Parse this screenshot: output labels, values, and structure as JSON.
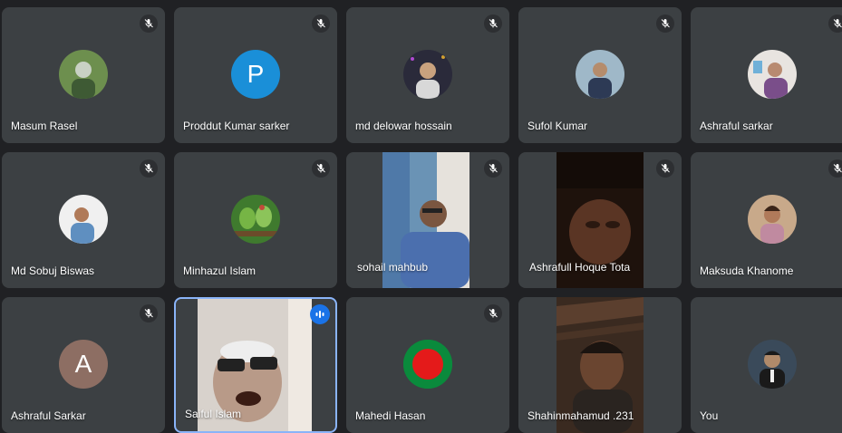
{
  "participants": [
    {
      "name": "Masum Rasel",
      "avatar_type": "photo",
      "avatar_icon": "person-photo-icon",
      "colors": [
        "#6d8f4e",
        "#c9d1c4",
        "#3e5a34"
      ],
      "muted": true
    },
    {
      "name": "Proddut Kumar sarker",
      "avatar_type": "letter",
      "letter": "P",
      "colors": [
        "#1a8fd8"
      ],
      "muted": true
    },
    {
      "name": "md delowar hossain",
      "avatar_type": "photo",
      "avatar_icon": "person-photo-icon",
      "colors": [
        "#2a2a3a",
        "#c9a27e",
        "#6b4b8a"
      ],
      "muted": true
    },
    {
      "name": "Sufol Kumar",
      "avatar_type": "photo",
      "avatar_icon": "person-photo-icon",
      "colors": [
        "#9fb8c8",
        "#b58c6c",
        "#2d3a55"
      ],
      "muted": true
    },
    {
      "name": "Ashraful sarkar",
      "avatar_type": "photo",
      "avatar_icon": "person-photo-icon",
      "colors": [
        "#e8e4e0",
        "#b88a70",
        "#7a4e8a"
      ],
      "muted": true
    },
    {
      "name": "Md Sobuj Biswas",
      "avatar_type": "photo",
      "avatar_icon": "person-photo-icon",
      "colors": [
        "#f0f0f0",
        "#b07a58",
        "#5f8fc0"
      ],
      "muted": true
    },
    {
      "name": "Minhazul Islam",
      "avatar_type": "photo",
      "avatar_icon": "parrots-photo-icon",
      "colors": [
        "#3f7a2e",
        "#76b545",
        "#c24a3a"
      ],
      "muted": true
    },
    {
      "name": "sohail mahbub",
      "avatar_type": "video",
      "video_icon": "camera-feed-icon",
      "colors": [
        "#5a8fb0",
        "#4f79a8",
        "#3b3b3b"
      ],
      "muted": true
    },
    {
      "name": "Ashrafull Hoque Tota",
      "avatar_type": "video",
      "video_icon": "camera-feed-icon",
      "colors": [
        "#2a1a12",
        "#5a3524",
        "#140c08"
      ],
      "muted": true
    },
    {
      "name": "Maksuda Khanome",
      "avatar_type": "photo",
      "avatar_icon": "person-photo-icon",
      "colors": [
        "#c8a98a",
        "#b07a5a",
        "#c08aa0"
      ],
      "muted": true
    },
    {
      "name": "Ashraful Sarkar",
      "avatar_type": "letter",
      "letter": "A",
      "colors": [
        "#8d6e63"
      ],
      "muted": true
    },
    {
      "name": "Saiful Islam",
      "avatar_type": "video",
      "video_icon": "camera-feed-icon",
      "colors": [
        "#d8d2cc",
        "#b89a88",
        "#222222"
      ],
      "muted": false,
      "speaking": true
    },
    {
      "name": "Mahedi Hasan",
      "avatar_type": "flag",
      "avatar_icon": "bangladesh-flag-icon",
      "colors": [
        "#0a8a3c",
        "#e41a1a"
      ],
      "muted": true
    },
    {
      "name": "Shahinmahamud .231",
      "avatar_type": "video",
      "video_icon": "camera-feed-icon",
      "colors": [
        "#3a2a20",
        "#5b3f2e",
        "#1b1410"
      ],
      "muted": false
    },
    {
      "name": "You",
      "avatar_type": "photo",
      "avatar_icon": "person-photo-icon",
      "colors": [
        "#3a4a5a",
        "#b08a6a",
        "#1a1a1a"
      ],
      "muted": false
    }
  ],
  "icons": {
    "muted_mic": "mic-off-icon",
    "speaking": "audio-level-icon"
  }
}
